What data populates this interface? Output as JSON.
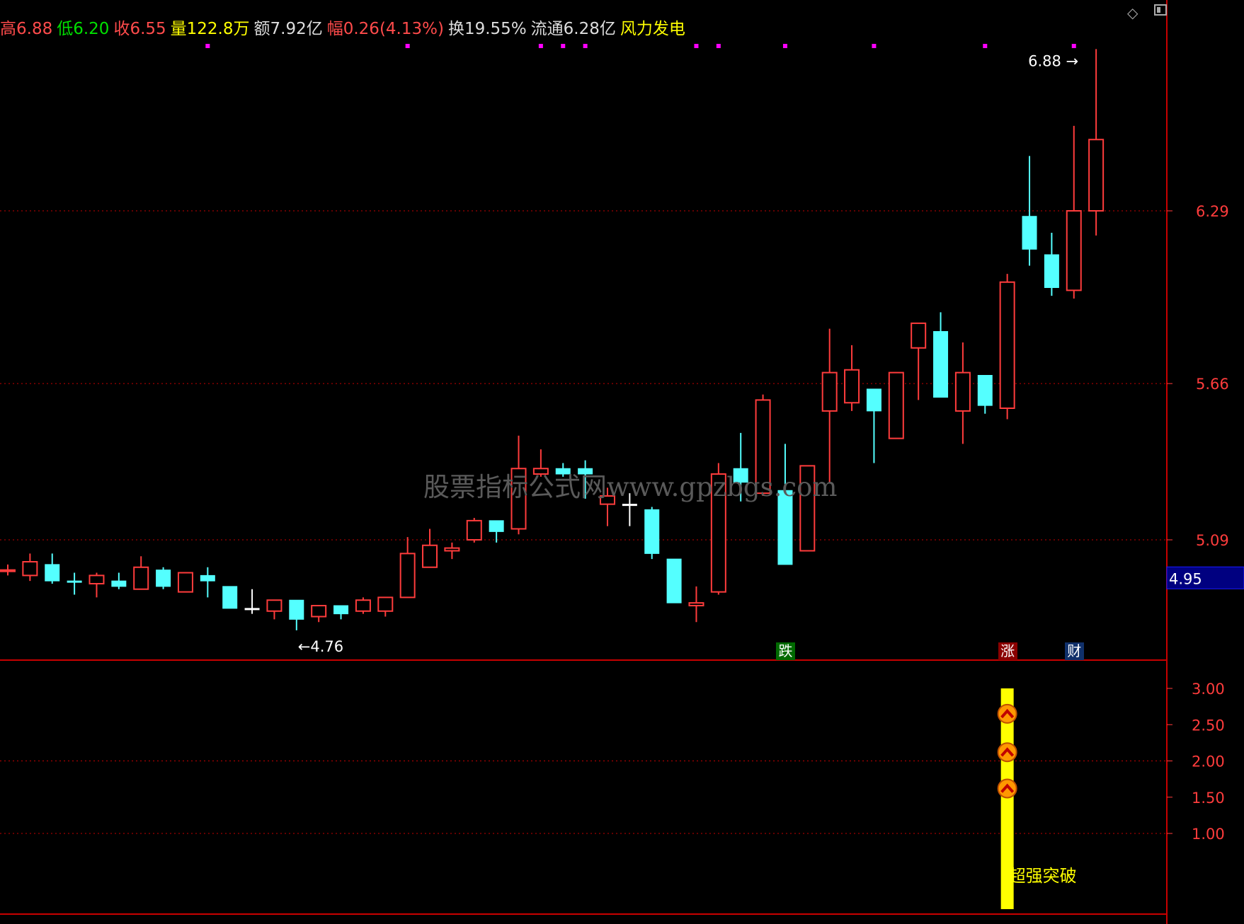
{
  "info_bar": [
    {
      "label": "高",
      "value": "6.88",
      "label_color": "#ff4b4b",
      "value_color": "#ff4b4b"
    },
    {
      "label": "低",
      "value": "6.20",
      "label_color": "#00e000",
      "value_color": "#00e000"
    },
    {
      "label": "收",
      "value": "6.55",
      "label_color": "#ff4b4b",
      "value_color": "#ff4b4b"
    },
    {
      "label": "量",
      "value": "122.8万",
      "label_color": "#ffff00",
      "value_color": "#ffff00"
    },
    {
      "label": "额",
      "value": "7.92亿",
      "label_color": "#dddddd",
      "value_color": "#dddddd"
    },
    {
      "label": "幅",
      "value": "0.26(4.13%)",
      "label_color": "#ff4b4b",
      "value_color": "#ff4b4b"
    },
    {
      "label": "换",
      "value": "19.55%",
      "label_color": "#dddddd",
      "value_color": "#dddddd"
    },
    {
      "label": "流通",
      "value": "6.28亿",
      "label_color": "#dddddd",
      "value_color": "#dddddd"
    },
    {
      "label": "风力发电",
      "value": "",
      "label_color": "#ffff00",
      "value_color": "#ffff00"
    }
  ],
  "watermark": "股票指标公式网www.gpzbgs.com",
  "tags": [
    {
      "text": "跌",
      "bg": "#006a00"
    },
    {
      "text": "涨",
      "bg": "#8a0000"
    },
    {
      "text": "财",
      "bg": "#10306a"
    }
  ],
  "icons": [
    "diamond-icon",
    "window-toggle-icon",
    "chevron-up-badge-icon"
  ],
  "colors": {
    "up": "#ff3c3c",
    "down": "#54ffff",
    "doji": "#ffffff",
    "grid": "#c80000",
    "axis": "#ff3c3c",
    "signal": "#ffff00",
    "marker": "#ff00ff"
  },
  "chart_data": [
    {
      "type": "candlestick",
      "ylim": [
        4.5,
        7.1
      ],
      "y_ticks": [
        6.29,
        5.66,
        5.09
      ],
      "y_tick_labels": [
        "6.29",
        "5.66",
        "5.09"
      ],
      "current_price_label": "4.95",
      "annotations": [
        {
          "text": "6.88",
          "arrow": "→",
          "candle_index": 49,
          "value": 6.88
        },
        {
          "text": "4.76",
          "arrow": "←",
          "candle_index": 13,
          "value": 4.76
        }
      ],
      "candles": [
        {
          "o": 4.98,
          "h": 5.0,
          "l": 4.96,
          "c": 4.98,
          "dir": "up"
        },
        {
          "o": 4.96,
          "h": 5.04,
          "l": 4.94,
          "c": 5.01,
          "dir": "up"
        },
        {
          "o": 5.0,
          "h": 5.04,
          "l": 4.93,
          "c": 4.94,
          "dir": "down"
        },
        {
          "o": 4.94,
          "h": 4.97,
          "l": 4.89,
          "c": 4.94,
          "dir": "down"
        },
        {
          "o": 4.93,
          "h": 4.97,
          "l": 4.88,
          "c": 4.96,
          "dir": "up"
        },
        {
          "o": 4.94,
          "h": 4.97,
          "l": 4.91,
          "c": 4.92,
          "dir": "down"
        },
        {
          "o": 4.91,
          "h": 5.03,
          "l": 4.91,
          "c": 4.99,
          "dir": "up"
        },
        {
          "o": 4.98,
          "h": 4.99,
          "l": 4.91,
          "c": 4.92,
          "dir": "down"
        },
        {
          "o": 4.9,
          "h": 4.97,
          "l": 4.9,
          "c": 4.97,
          "dir": "up"
        },
        {
          "o": 4.96,
          "h": 4.99,
          "l": 4.88,
          "c": 4.94,
          "dir": "down"
        },
        {
          "o": 4.92,
          "h": 4.92,
          "l": 4.84,
          "c": 4.84,
          "dir": "down"
        },
        {
          "o": 4.84,
          "h": 4.91,
          "l": 4.82,
          "c": 4.84,
          "dir": "doji"
        },
        {
          "o": 4.83,
          "h": 4.87,
          "l": 4.8,
          "c": 4.87,
          "dir": "up"
        },
        {
          "o": 4.87,
          "h": 4.87,
          "l": 4.76,
          "c": 4.8,
          "dir": "down"
        },
        {
          "o": 4.81,
          "h": 4.85,
          "l": 4.79,
          "c": 4.85,
          "dir": "up"
        },
        {
          "o": 4.85,
          "h": 4.85,
          "l": 4.8,
          "c": 4.82,
          "dir": "down"
        },
        {
          "o": 4.83,
          "h": 4.88,
          "l": 4.82,
          "c": 4.87,
          "dir": "up"
        },
        {
          "o": 4.83,
          "h": 4.88,
          "l": 4.81,
          "c": 4.88,
          "dir": "up"
        },
        {
          "o": 4.88,
          "h": 5.1,
          "l": 4.88,
          "c": 5.04,
          "dir": "up"
        },
        {
          "o": 4.99,
          "h": 5.13,
          "l": 4.99,
          "c": 5.07,
          "dir": "up"
        },
        {
          "o": 5.05,
          "h": 5.08,
          "l": 5.02,
          "c": 5.06,
          "dir": "up"
        },
        {
          "o": 5.09,
          "h": 5.17,
          "l": 5.08,
          "c": 5.16,
          "dir": "up"
        },
        {
          "o": 5.16,
          "h": 5.16,
          "l": 5.08,
          "c": 5.12,
          "dir": "down"
        },
        {
          "o": 5.13,
          "h": 5.47,
          "l": 5.11,
          "c": 5.35,
          "dir": "up"
        },
        {
          "o": 5.33,
          "h": 5.42,
          "l": 5.32,
          "c": 5.35,
          "dir": "up"
        },
        {
          "o": 5.35,
          "h": 5.37,
          "l": 5.32,
          "c": 5.33,
          "dir": "down"
        },
        {
          "o": 5.35,
          "h": 5.38,
          "l": 5.24,
          "c": 5.33,
          "dir": "down"
        },
        {
          "o": 5.22,
          "h": 5.28,
          "l": 5.14,
          "c": 5.25,
          "dir": "up"
        },
        {
          "o": 5.22,
          "h": 5.26,
          "l": 5.14,
          "c": 5.22,
          "dir": "doji"
        },
        {
          "o": 5.2,
          "h": 5.21,
          "l": 5.02,
          "c": 5.04,
          "dir": "down"
        },
        {
          "o": 5.02,
          "h": 5.02,
          "l": 4.86,
          "c": 4.86,
          "dir": "down"
        },
        {
          "o": 4.85,
          "h": 4.92,
          "l": 4.79,
          "c": 4.86,
          "dir": "up"
        },
        {
          "o": 4.9,
          "h": 5.37,
          "l": 4.89,
          "c": 5.33,
          "dir": "up"
        },
        {
          "o": 5.35,
          "h": 5.48,
          "l": 5.23,
          "c": 5.3,
          "dir": "down"
        },
        {
          "o": 5.26,
          "h": 5.62,
          "l": 5.25,
          "c": 5.6,
          "dir": "up"
        },
        {
          "o": 5.27,
          "h": 5.44,
          "l": 5.01,
          "c": 5.0,
          "dir": "down"
        },
        {
          "o": 5.05,
          "h": 5.35,
          "l": 5.05,
          "c": 5.36,
          "dir": "up"
        },
        {
          "o": 5.56,
          "h": 5.86,
          "l": 5.3,
          "c": 5.7,
          "dir": "up"
        },
        {
          "o": 5.59,
          "h": 5.8,
          "l": 5.56,
          "c": 5.71,
          "dir": "up"
        },
        {
          "o": 5.64,
          "h": 5.64,
          "l": 5.37,
          "c": 5.56,
          "dir": "down"
        },
        {
          "o": 5.46,
          "h": 5.7,
          "l": 5.46,
          "c": 5.7,
          "dir": "up"
        },
        {
          "o": 5.79,
          "h": 5.85,
          "l": 5.6,
          "c": 5.88,
          "dir": "up"
        },
        {
          "o": 5.85,
          "h": 5.92,
          "l": 5.64,
          "c": 5.61,
          "dir": "down"
        },
        {
          "o": 5.56,
          "h": 5.81,
          "l": 5.44,
          "c": 5.7,
          "dir": "up"
        },
        {
          "o": 5.69,
          "h": 5.69,
          "l": 5.55,
          "c": 5.58,
          "dir": "down"
        },
        {
          "o": 5.57,
          "h": 6.06,
          "l": 5.53,
          "c": 6.03,
          "dir": "up"
        },
        {
          "o": 6.27,
          "h": 6.49,
          "l": 6.09,
          "c": 6.15,
          "dir": "down"
        },
        {
          "o": 6.13,
          "h": 6.21,
          "l": 5.98,
          "c": 6.01,
          "dir": "down"
        },
        {
          "o": 6.0,
          "h": 6.6,
          "l": 5.97,
          "c": 6.29,
          "dir": "up"
        },
        {
          "o": 6.29,
          "h": 6.88,
          "l": 6.2,
          "c": 6.55,
          "dir": "up"
        }
      ],
      "top_markers_candle_index": [
        9,
        18,
        24,
        25,
        26,
        31,
        32,
        35,
        39,
        44,
        48
      ]
    },
    {
      "type": "bar",
      "label": "超强突破",
      "ylim": [
        0,
        3.35
      ],
      "y_ticks": [
        3.0,
        2.5,
        2.0,
        1.5,
        1.0
      ],
      "y_tick_labels": [
        "3.00",
        "2.50",
        "2.00",
        "1.50",
        "1.00"
      ],
      "signal_candle_index": 45,
      "signal_value": 3.0,
      "badge_values": [
        2.65,
        2.12,
        1.62
      ]
    }
  ],
  "tag_candle_index": [
    35,
    45,
    48
  ]
}
